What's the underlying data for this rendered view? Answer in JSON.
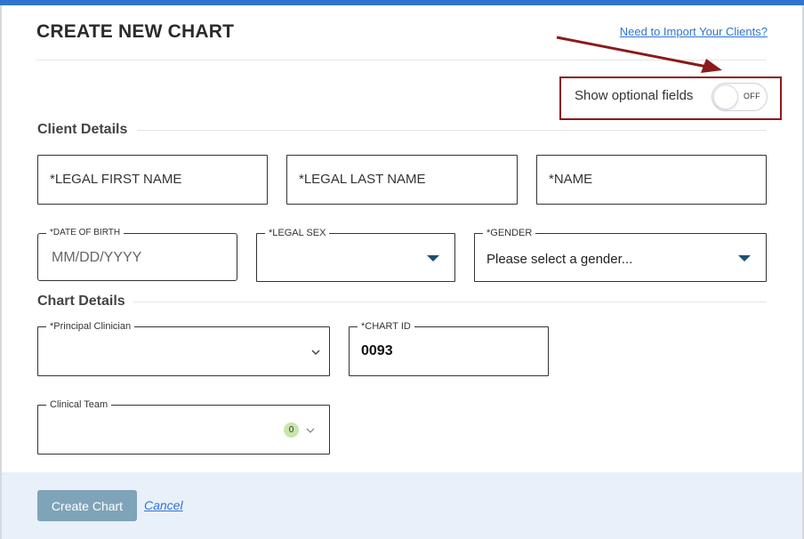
{
  "header": {
    "title": "CREATE NEW CHART",
    "import_link": "Need to Import Your Clients?"
  },
  "optional_fields": {
    "label": "Show optional fields",
    "toggle_state": "OFF"
  },
  "client_details": {
    "section_title": "Client Details",
    "legal_first_name": {
      "placeholder": "*LEGAL FIRST NAME"
    },
    "legal_last_name": {
      "placeholder": "*LEGAL LAST NAME"
    },
    "name": {
      "placeholder": "*NAME"
    },
    "date_of_birth": {
      "label": "*DATE OF BIRTH",
      "placeholder": "MM/DD/YYYY"
    },
    "legal_sex": {
      "label": "*LEGAL SEX",
      "value": ""
    },
    "gender": {
      "label": "*GENDER",
      "value": "Please select a gender..."
    }
  },
  "chart_details": {
    "section_title": "Chart Details",
    "principal_clinician": {
      "label": "*Principal Clinician",
      "value": ""
    },
    "chart_id": {
      "label": "*CHART ID",
      "value": "0093"
    },
    "clinical_team": {
      "label": "Clinical Team",
      "count": "0"
    }
  },
  "footer": {
    "create_button": "Create Chart",
    "cancel_link": "Cancel"
  },
  "colors": {
    "accent": "#2f74d0",
    "highlight_annotation": "#8b1a1a",
    "primary_button_disabled": "#7fa3b8",
    "footer_background": "#e8f0f9",
    "team_badge": "#c7e6a8"
  },
  "icons": {
    "select_caret": "caret-down-icon",
    "principal_clinician_chevron": "chevron-down-icon",
    "annotation_arrow": "arrow-annotation-icon"
  }
}
